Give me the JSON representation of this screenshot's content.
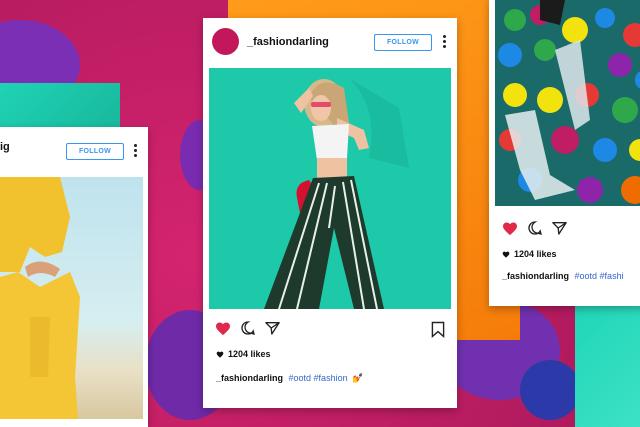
{
  "colors": {
    "background": "#c01e64",
    "follow_blue": "#3897f0",
    "heart_red": "#e0284a",
    "hashtag_blue": "#3567c8"
  },
  "left_post": {
    "username": "ig",
    "follow_label": "FOLLOW"
  },
  "center_post": {
    "username": "_fashiondarling",
    "follow_label": "FOLLOW",
    "likes": "1204 likes",
    "caption_user": "_fashiondarling",
    "caption_tags": "#ootd #fashion",
    "caption_emoji": "💅"
  },
  "right_post": {
    "likes": "1204 likes",
    "caption_user": "_fashiondarling",
    "caption_tags": "#ootd #fashi"
  },
  "icons": [
    "heart-icon",
    "comment-icon",
    "share-icon",
    "bookmark-icon",
    "more-options-icon"
  ]
}
